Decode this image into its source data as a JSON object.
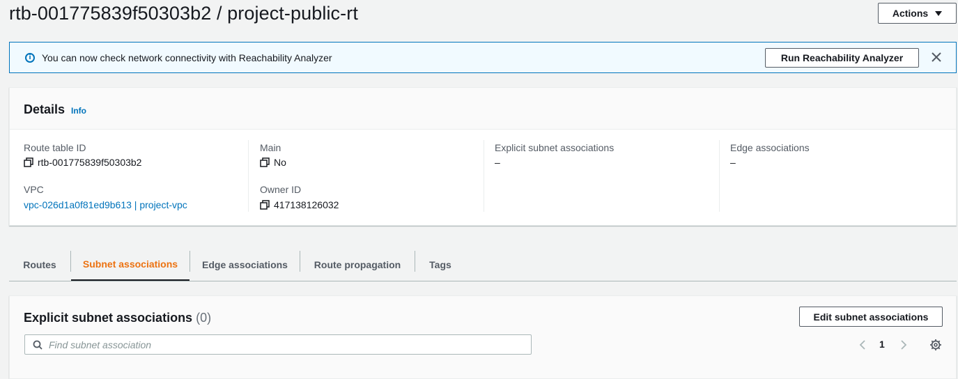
{
  "header": {
    "title": "rtb-001775839f50303b2 / project-public-rt",
    "actions_label": "Actions"
  },
  "flash": {
    "message": "You can now check network connectivity with Reachability Analyzer",
    "button_label": "Run Reachability Analyzer"
  },
  "details": {
    "title": "Details",
    "info_label": "Info",
    "route_table_id": {
      "label": "Route table ID",
      "value": "rtb-001775839f50303b2"
    },
    "vpc": {
      "label": "VPC",
      "value": "vpc-026d1a0f81ed9b613 | project-vpc"
    },
    "main": {
      "label": "Main",
      "value": "No"
    },
    "owner_id": {
      "label": "Owner ID",
      "value": "417138126032"
    },
    "explicit_subnet": {
      "label": "Explicit subnet associations",
      "value": "–"
    },
    "edge": {
      "label": "Edge associations",
      "value": "–"
    }
  },
  "tabs": [
    {
      "label": "Routes",
      "active": false
    },
    {
      "label": "Subnet associations",
      "active": true
    },
    {
      "label": "Edge associations",
      "active": false
    },
    {
      "label": "Route propagation",
      "active": false
    },
    {
      "label": "Tags",
      "active": false
    }
  ],
  "assoc": {
    "title": "Explicit subnet associations",
    "count": "(0)",
    "edit_label": "Edit subnet associations",
    "search_placeholder": "Find subnet association",
    "page": "1"
  },
  "colors": {
    "accent_link": "#0073bb",
    "active_tab": "#ec7211",
    "flash_bg": "#f1faff"
  }
}
